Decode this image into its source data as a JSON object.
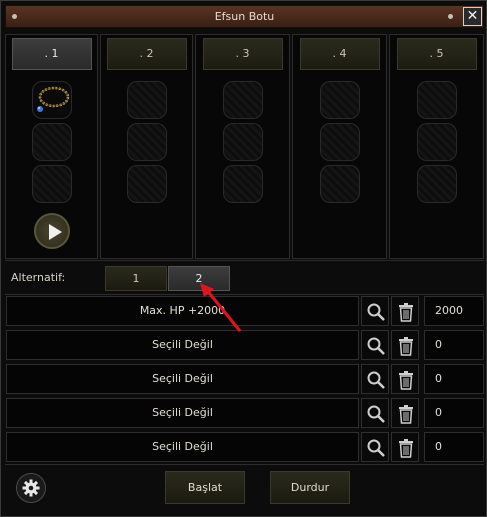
{
  "window": {
    "title": "Efsun Botu",
    "close_label": "✕"
  },
  "columns": [
    {
      "label": ". 1",
      "active": true,
      "has_item": true,
      "has_play": true
    },
    {
      "label": ". 2",
      "active": false
    },
    {
      "label": ". 3",
      "active": false
    },
    {
      "label": ". 4",
      "active": false
    },
    {
      "label": ". 5",
      "active": false
    }
  ],
  "alternatif": {
    "label": "Alternatif:",
    "tabs": [
      {
        "label": "1",
        "active": false
      },
      {
        "label": "2",
        "active": true
      }
    ]
  },
  "rows": [
    {
      "label": "Max. HP +2000",
      "value": "2000"
    },
    {
      "label": "Seçili Değil",
      "value": "0"
    },
    {
      "label": "Seçili Değil",
      "value": "0"
    },
    {
      "label": "Seçili Değil",
      "value": "0"
    },
    {
      "label": "Seçili Değil",
      "value": "0"
    }
  ],
  "buttons": {
    "start": "Başlat",
    "stop": "Durdur"
  },
  "icons": {
    "search": "search-icon",
    "delete": "trash-icon",
    "settings": "gear-icon",
    "play": "play-icon",
    "item": "necklace-icon"
  },
  "colors": {
    "title_bar": "#4a2a1c",
    "annotation_arrow": "#e0141e"
  }
}
